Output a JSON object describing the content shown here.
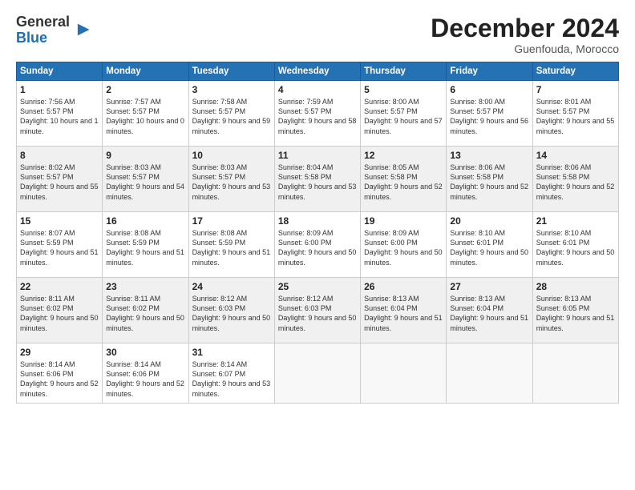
{
  "logo": {
    "general": "General",
    "blue": "Blue"
  },
  "header": {
    "month": "December 2024",
    "location": "Guenfouda, Morocco"
  },
  "days_of_week": [
    "Sunday",
    "Monday",
    "Tuesday",
    "Wednesday",
    "Thursday",
    "Friday",
    "Saturday"
  ],
  "weeks": [
    [
      {
        "day": "1",
        "sunrise": "7:56 AM",
        "sunset": "5:57 PM",
        "daylight": "10 hours and 1 minute."
      },
      {
        "day": "2",
        "sunrise": "7:57 AM",
        "sunset": "5:57 PM",
        "daylight": "10 hours and 0 minutes."
      },
      {
        "day": "3",
        "sunrise": "7:58 AM",
        "sunset": "5:57 PM",
        "daylight": "9 hours and 59 minutes."
      },
      {
        "day": "4",
        "sunrise": "7:59 AM",
        "sunset": "5:57 PM",
        "daylight": "9 hours and 58 minutes."
      },
      {
        "day": "5",
        "sunrise": "8:00 AM",
        "sunset": "5:57 PM",
        "daylight": "9 hours and 57 minutes."
      },
      {
        "day": "6",
        "sunrise": "8:00 AM",
        "sunset": "5:57 PM",
        "daylight": "9 hours and 56 minutes."
      },
      {
        "day": "7",
        "sunrise": "8:01 AM",
        "sunset": "5:57 PM",
        "daylight": "9 hours and 55 minutes."
      }
    ],
    [
      {
        "day": "8",
        "sunrise": "8:02 AM",
        "sunset": "5:57 PM",
        "daylight": "9 hours and 55 minutes."
      },
      {
        "day": "9",
        "sunrise": "8:03 AM",
        "sunset": "5:57 PM",
        "daylight": "9 hours and 54 minutes."
      },
      {
        "day": "10",
        "sunrise": "8:03 AM",
        "sunset": "5:57 PM",
        "daylight": "9 hours and 53 minutes."
      },
      {
        "day": "11",
        "sunrise": "8:04 AM",
        "sunset": "5:58 PM",
        "daylight": "9 hours and 53 minutes."
      },
      {
        "day": "12",
        "sunrise": "8:05 AM",
        "sunset": "5:58 PM",
        "daylight": "9 hours and 52 minutes."
      },
      {
        "day": "13",
        "sunrise": "8:06 AM",
        "sunset": "5:58 PM",
        "daylight": "9 hours and 52 minutes."
      },
      {
        "day": "14",
        "sunrise": "8:06 AM",
        "sunset": "5:58 PM",
        "daylight": "9 hours and 52 minutes."
      }
    ],
    [
      {
        "day": "15",
        "sunrise": "8:07 AM",
        "sunset": "5:59 PM",
        "daylight": "9 hours and 51 minutes."
      },
      {
        "day": "16",
        "sunrise": "8:08 AM",
        "sunset": "5:59 PM",
        "daylight": "9 hours and 51 minutes."
      },
      {
        "day": "17",
        "sunrise": "8:08 AM",
        "sunset": "5:59 PM",
        "daylight": "9 hours and 51 minutes."
      },
      {
        "day": "18",
        "sunrise": "8:09 AM",
        "sunset": "6:00 PM",
        "daylight": "9 hours and 50 minutes."
      },
      {
        "day": "19",
        "sunrise": "8:09 AM",
        "sunset": "6:00 PM",
        "daylight": "9 hours and 50 minutes."
      },
      {
        "day": "20",
        "sunrise": "8:10 AM",
        "sunset": "6:01 PM",
        "daylight": "9 hours and 50 minutes."
      },
      {
        "day": "21",
        "sunrise": "8:10 AM",
        "sunset": "6:01 PM",
        "daylight": "9 hours and 50 minutes."
      }
    ],
    [
      {
        "day": "22",
        "sunrise": "8:11 AM",
        "sunset": "6:02 PM",
        "daylight": "9 hours and 50 minutes."
      },
      {
        "day": "23",
        "sunrise": "8:11 AM",
        "sunset": "6:02 PM",
        "daylight": "9 hours and 50 minutes."
      },
      {
        "day": "24",
        "sunrise": "8:12 AM",
        "sunset": "6:03 PM",
        "daylight": "9 hours and 50 minutes."
      },
      {
        "day": "25",
        "sunrise": "8:12 AM",
        "sunset": "6:03 PM",
        "daylight": "9 hours and 50 minutes."
      },
      {
        "day": "26",
        "sunrise": "8:13 AM",
        "sunset": "6:04 PM",
        "daylight": "9 hours and 51 minutes."
      },
      {
        "day": "27",
        "sunrise": "8:13 AM",
        "sunset": "6:04 PM",
        "daylight": "9 hours and 51 minutes."
      },
      {
        "day": "28",
        "sunrise": "8:13 AM",
        "sunset": "6:05 PM",
        "daylight": "9 hours and 51 minutes."
      }
    ],
    [
      {
        "day": "29",
        "sunrise": "8:14 AM",
        "sunset": "6:06 PM",
        "daylight": "9 hours and 52 minutes."
      },
      {
        "day": "30",
        "sunrise": "8:14 AM",
        "sunset": "6:06 PM",
        "daylight": "9 hours and 52 minutes."
      },
      {
        "day": "31",
        "sunrise": "8:14 AM",
        "sunset": "6:07 PM",
        "daylight": "9 hours and 53 minutes."
      },
      null,
      null,
      null,
      null
    ]
  ],
  "labels": {
    "sunrise": "Sunrise:",
    "sunset": "Sunset:",
    "daylight": "Daylight:"
  }
}
